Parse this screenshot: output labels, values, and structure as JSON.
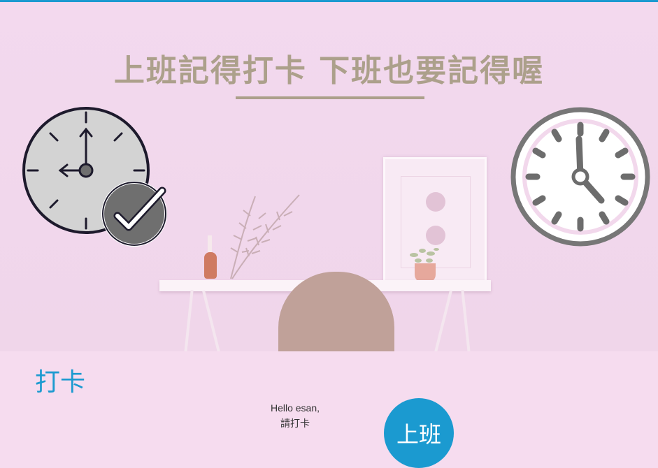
{
  "hero": {
    "title": "上班記得打卡 下班也要記得喔",
    "title_color": "#aca08b",
    "left_icon": "clock-with-checkmark-icon",
    "right_icon": "wall-clock-icon"
  },
  "punch_section": {
    "heading": "打卡",
    "greeting_line1": "Hello esan,",
    "greeting_line2": "請打卡",
    "button_label": "上班"
  },
  "colors": {
    "accent": "#1b9ad0",
    "background": "#f6dcef"
  }
}
